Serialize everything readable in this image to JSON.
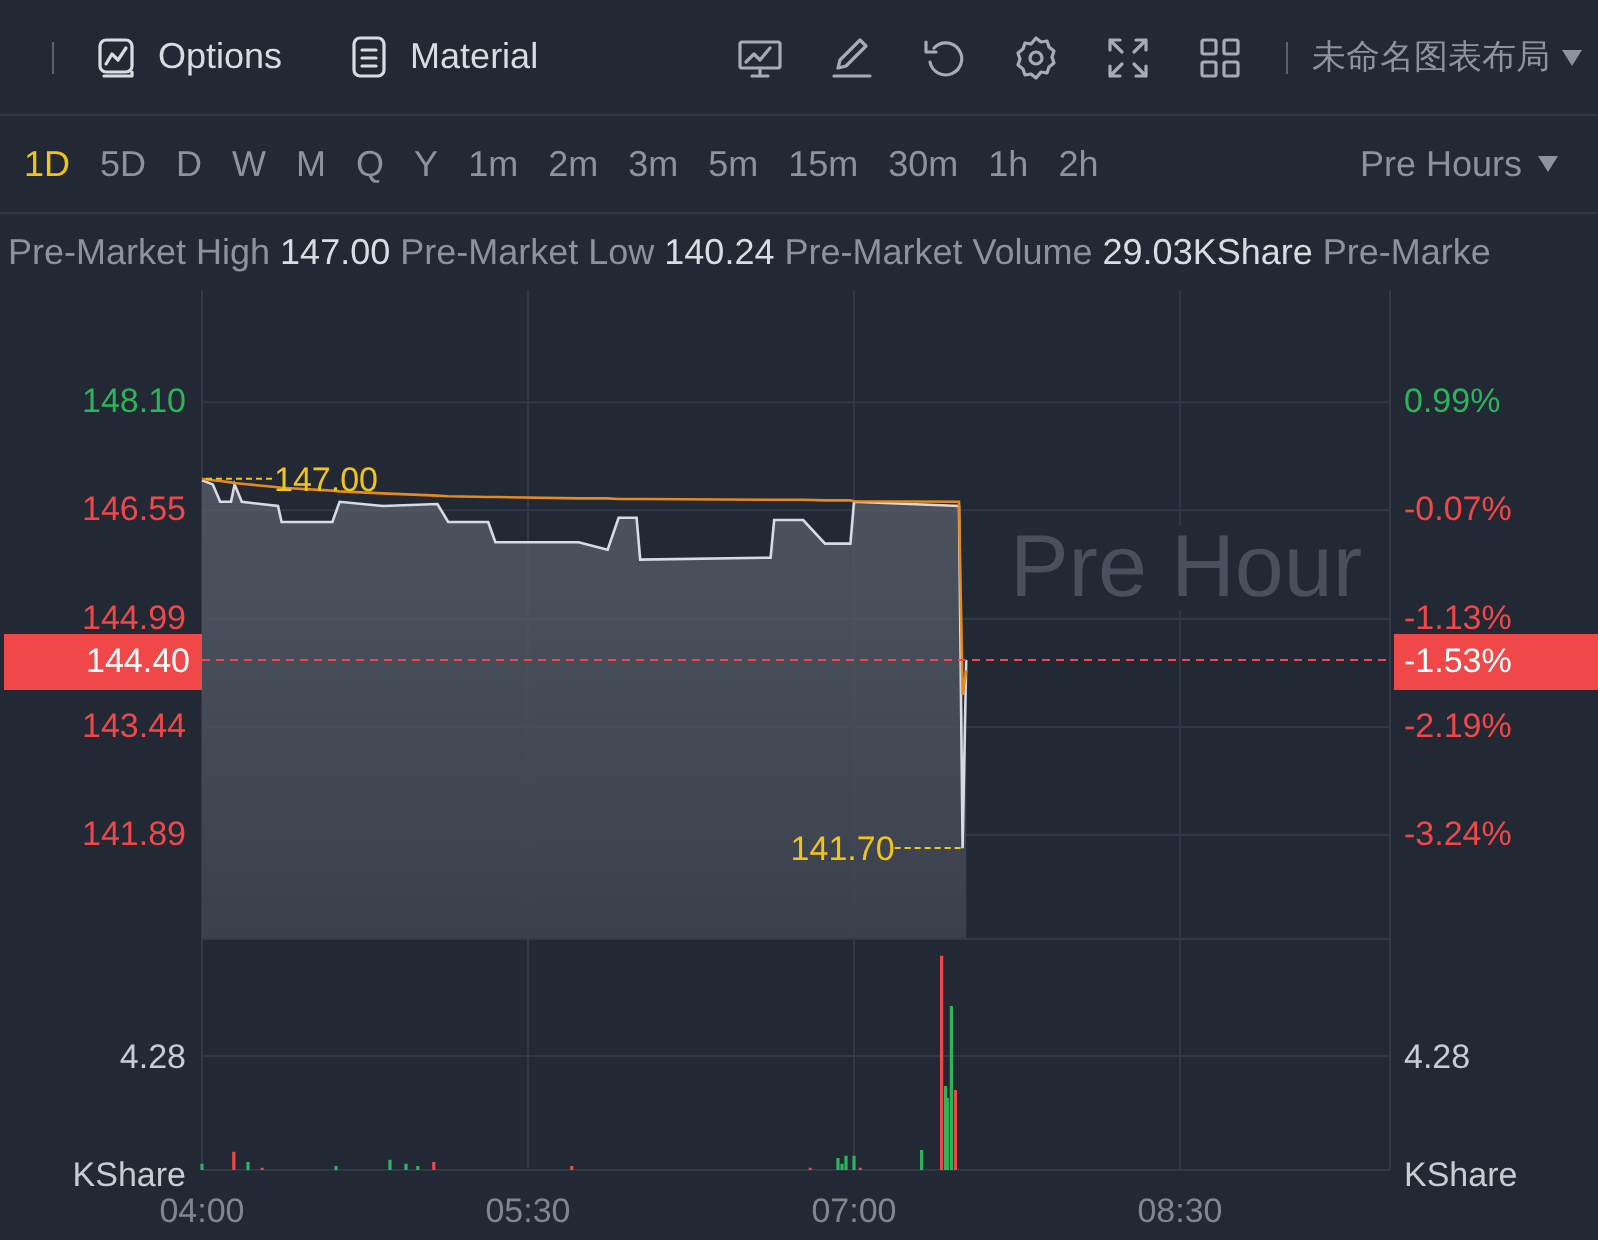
{
  "toolbar": {
    "buttons": [
      {
        "label": "Options",
        "kind": "chart"
      },
      {
        "label": "Material",
        "kind": "document"
      }
    ],
    "tools": [
      {
        "kind": "monitor"
      },
      {
        "kind": "pencil"
      },
      {
        "kind": "refresh"
      },
      {
        "kind": "settings"
      },
      {
        "kind": "fullscreen"
      },
      {
        "kind": "grid"
      }
    ],
    "layout": {
      "label": "未命名图表布局"
    }
  },
  "intervals": [
    {
      "label": "1D",
      "selected": true
    },
    {
      "label": "5D",
      "selected": false
    },
    {
      "label": "D",
      "selected": false
    },
    {
      "label": "W",
      "selected": false
    },
    {
      "label": "M",
      "selected": false
    },
    {
      "label": "Q",
      "selected": false
    },
    {
      "label": "Y",
      "selected": false
    },
    {
      "label": "1m",
      "selected": false
    },
    {
      "label": "2m",
      "selected": false
    },
    {
      "label": "3m",
      "selected": false
    },
    {
      "label": "5m",
      "selected": false
    },
    {
      "label": "15m",
      "selected": false
    },
    {
      "label": "30m",
      "selected": false
    },
    {
      "label": "1h",
      "selected": false
    },
    {
      "label": "2h",
      "selected": false
    }
  ],
  "session": {
    "label": "Pre Hours"
  },
  "stats": [
    {
      "label": "Pre-Market High",
      "value": "147.00"
    },
    {
      "label": "Pre-Market Low",
      "value": "140.24"
    },
    {
      "label": "Pre-Market Volume",
      "value": "29.03KShare"
    },
    {
      "label": "Pre-Marke"
    }
  ],
  "price_chart": {
    "background_text": "Pre Hour",
    "percent_ticks": [
      {
        "label": "0.99%",
        "color": "#2db35a"
      },
      {
        "label": "-0.07%",
        "color": "#f04848"
      },
      {
        "label": "-1.13%",
        "color": "#f04848"
      },
      {
        "label": "-2.19%",
        "color": "#f04848"
      },
      {
        "label": "-3.24%",
        "color": "#f04848"
      }
    ],
    "last_change": "-1.53%",
    "chart_data": {
      "type": "line",
      "x": [
        240,
        243,
        245,
        248,
        249,
        251,
        261,
        262,
        276,
        278,
        290,
        305,
        308,
        319,
        321,
        344,
        352,
        355,
        360,
        361,
        397,
        398,
        406,
        412,
        419,
        420,
        449,
        450,
        451
      ],
      "series": [
        {
          "color": "#d8dce2",
          "values": [
            146.98,
            146.92,
            146.67,
            146.67,
            146.92,
            146.67,
            146.61,
            146.38,
            146.38,
            146.67,
            146.61,
            146.64,
            146.38,
            146.38,
            146.09,
            146.09,
            145.98,
            146.44,
            146.44,
            145.84,
            145.87,
            146.41,
            146.41,
            146.07,
            146.07,
            146.67,
            146.61,
            141.7,
            144.4
          ]
        },
        {
          "color": "#e58a1f",
          "values": [
            147.0,
            146.98,
            146.97,
            146.95,
            146.94,
            146.93,
            146.88,
            146.87,
            146.83,
            146.82,
            146.79,
            146.76,
            146.75,
            146.74,
            146.74,
            146.72,
            146.72,
            146.71,
            146.71,
            146.71,
            146.7,
            146.7,
            146.7,
            146.69,
            146.69,
            146.68,
            146.67,
            143.9,
            144.25
          ]
        }
      ],
      "xlim": [
        240,
        568
      ],
      "ylim": [
        140.41,
        149.71
      ],
      "grid": true,
      "yticks": [
        {
          "value": 148.1,
          "label": "148.10"
        },
        {
          "value": 146.55,
          "label": "146.55"
        },
        {
          "value": 144.99,
          "label": "144.99"
        },
        {
          "value": 143.44,
          "label": "143.44"
        },
        {
          "value": 141.89,
          "label": "141.89"
        }
      ],
      "annotations": [
        {
          "x": 240,
          "y": 147.0,
          "text": "147.00"
        },
        {
          "x": 450,
          "y": 141.7,
          "text": "141.70"
        }
      ],
      "ref_lines": [
        {
          "axis": "y",
          "value": 144.4,
          "label": "144.40",
          "color": "#f04848"
        }
      ]
    }
  },
  "volume_chart": {
    "right_tick": "4.28",
    "right_label": "KShare",
    "chart_data": {
      "type": "bar",
      "ylabel": "KShare",
      "x": [
        240,
        248.8,
        252.7,
        256.6,
        277,
        291.9,
        296.3,
        299.6,
        304,
        342.1,
        407.9,
        415.6,
        416.7,
        417.8,
        420,
        421.7,
        438.7,
        444.2,
        445.3,
        445.8,
        446.9,
        448
      ],
      "series": [
        {
          "color": "#2db35a",
          "values": [
            0.23,
            null,
            0.3,
            null,
            0.15,
            0.38,
            0.23,
            0.15,
            null,
            null,
            null,
            0.45,
            0.23,
            0.53,
            0.53,
            null,
            0.75,
            null,
            3.15,
            2.7,
            6.16,
            null
          ]
        },
        {
          "color": "#f04848",
          "values": [
            null,
            0.68,
            null,
            0.08,
            null,
            null,
            null,
            null,
            0.3,
            0.15,
            0.08,
            null,
            null,
            null,
            null,
            0.08,
            null,
            8.04,
            null,
            null,
            null,
            3.0
          ]
        }
      ],
      "xlim": [
        240,
        568
      ],
      "ylim": [
        0,
        8.71
      ],
      "grid": true,
      "xticks": [
        {
          "value": 240,
          "label": "04:00"
        },
        {
          "value": 330,
          "label": "05:30"
        },
        {
          "value": 420,
          "label": "07:00"
        },
        {
          "value": 510,
          "label": "08:30"
        }
      ],
      "yticks": [
        {
          "value": 4.28,
          "label": "4.28"
        }
      ]
    }
  }
}
